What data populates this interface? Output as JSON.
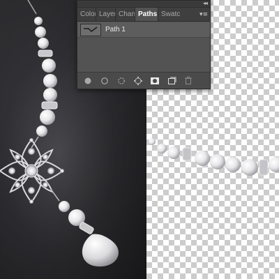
{
  "panel": {
    "collapse_glyph": "◂◂",
    "menu_glyph": "▾≡",
    "tabs": [
      {
        "label": "Color"
      },
      {
        "label": "Layer"
      },
      {
        "label": "Chan"
      },
      {
        "label": "Paths",
        "active": true
      },
      {
        "label": "Swatc"
      }
    ],
    "paths": [
      {
        "name": "Path 1"
      }
    ],
    "footer_buttons": [
      {
        "icon": "fill-path-icon"
      },
      {
        "icon": "stroke-path-icon"
      },
      {
        "icon": "load-selection-icon"
      },
      {
        "icon": "make-work-path-icon"
      },
      {
        "icon": "add-mask-icon"
      },
      {
        "icon": "new-path-icon"
      },
      {
        "icon": "trash-icon"
      }
    ]
  },
  "canvas": {
    "background_left": "#2a2a2e",
    "checker_light": "#ffffff",
    "checker_dark": "#cccccc"
  }
}
